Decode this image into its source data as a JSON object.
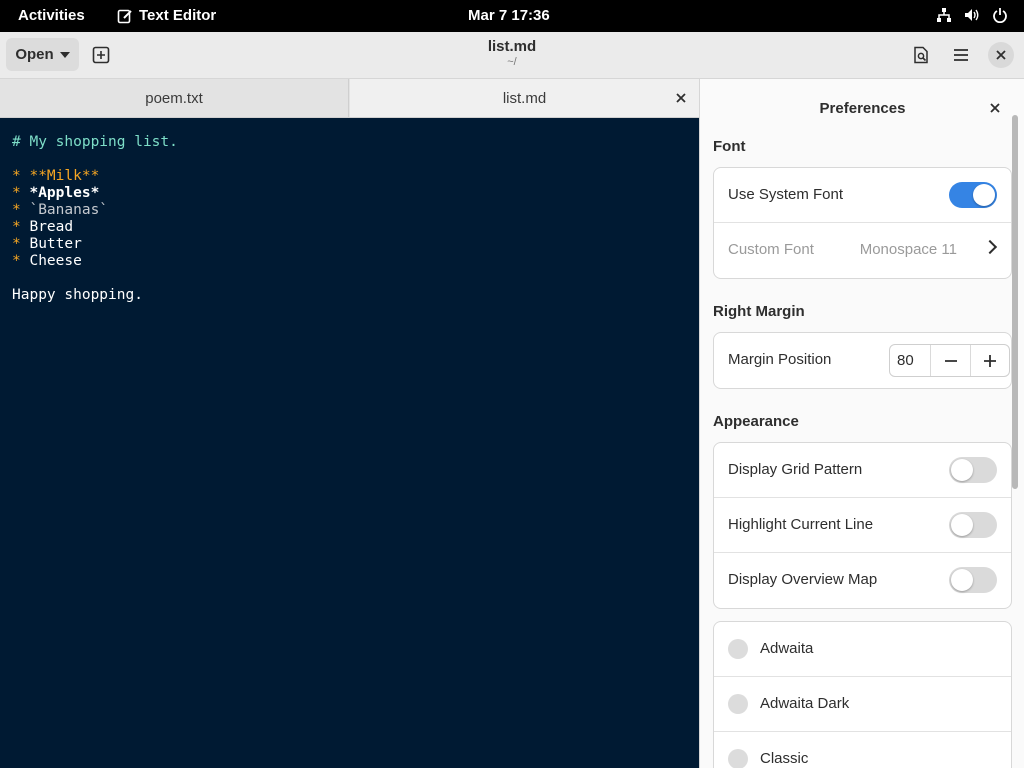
{
  "topbar": {
    "activities": "Activities",
    "app_name": "Text Editor",
    "clock": "Mar 7  17:36"
  },
  "headerbar": {
    "open_label": "Open",
    "title": "list.md",
    "subtitle": "~/"
  },
  "tabs": [
    {
      "label": "poem.txt"
    },
    {
      "label": "list.md"
    }
  ],
  "editor": {
    "heading": "# My shopping list.",
    "bullet": "* ",
    "items": [
      "**Milk**",
      "*Apples*",
      "`Bananas`",
      "Bread",
      "Butter",
      "Cheese"
    ],
    "footer": "Happy shopping."
  },
  "preferences": {
    "title": "Preferences",
    "font_section": "Font",
    "use_system_font": "Use System Font",
    "use_system_font_on": true,
    "custom_font": "Custom Font",
    "custom_font_value": "Monospace 11",
    "right_margin_section": "Right Margin",
    "margin_position": "Margin Position",
    "margin_value": "80",
    "appearance_section": "Appearance",
    "display_grid": "Display Grid Pattern",
    "display_grid_on": false,
    "highlight_line": "Highlight Current Line",
    "highlight_line_on": false,
    "overview_map": "Display Overview Map",
    "overview_map_on": false,
    "schemes": [
      "Adwaita",
      "Adwaita Dark",
      "Classic"
    ]
  },
  "colors": {
    "accent": "#3584e4",
    "editor_bg": "#001a33",
    "heading": "#7ddec8",
    "bullet": "#f5a623"
  }
}
